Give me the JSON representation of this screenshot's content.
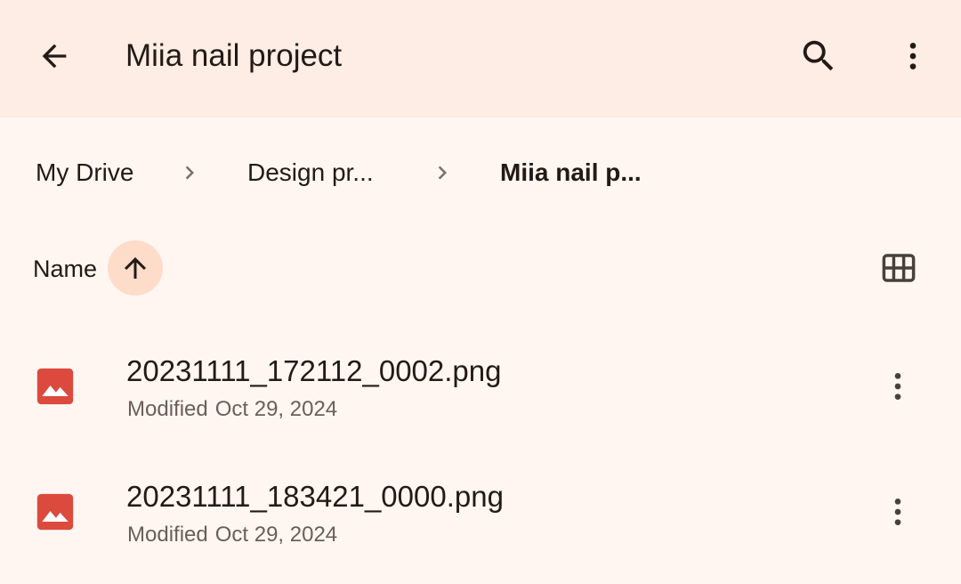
{
  "appbar": {
    "title": "Miia nail project",
    "back_icon": "arrow-back-icon",
    "search_icon": "search-icon",
    "more_icon": "more-vert-icon"
  },
  "breadcrumb": {
    "items": [
      {
        "label": "My Drive"
      },
      {
        "label": "Design pr..."
      },
      {
        "label": "Miia nail p..."
      }
    ],
    "separator_icon": "chevron-right-icon"
  },
  "sort": {
    "label": "Name",
    "direction_icon": "arrow-upward-icon",
    "view_icon": "grid-view-icon"
  },
  "files": [
    {
      "name": "20231111_172112_0002.png",
      "modified_label": "Modified",
      "modified_date": "Oct 29, 2024",
      "type_icon": "image-file-icon"
    },
    {
      "name": "20231111_183421_0000.png",
      "modified_label": "Modified",
      "modified_date": "Oct 29, 2024",
      "type_icon": "image-file-icon"
    }
  ],
  "colors": {
    "appbar_bg": "#FDEDE4",
    "page_bg": "#FFF6F2",
    "accent_chip": "#FDDCC9",
    "image_icon": "#DC4A3D"
  }
}
